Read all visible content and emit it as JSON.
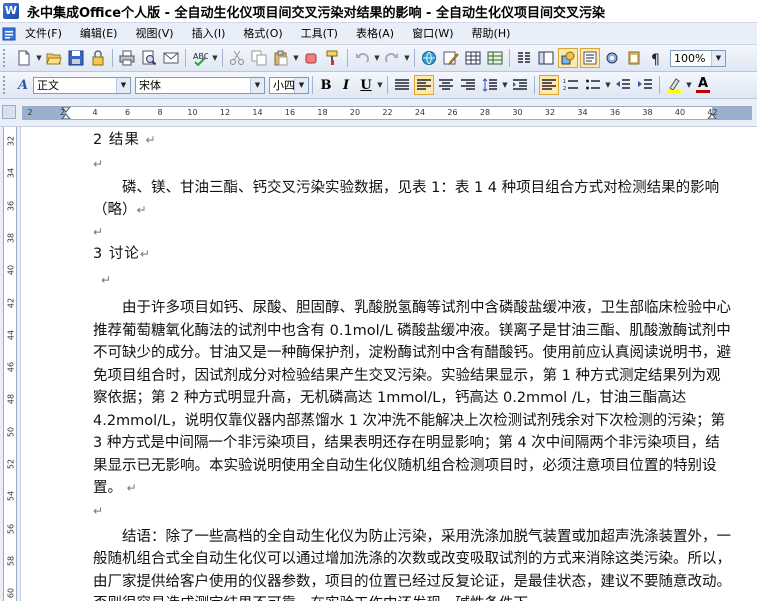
{
  "window": {
    "app_icon_glyph": "W",
    "title": "永中集成Office个人版 - 全自动生化仪项目间交叉污染对结果的影响 - 全自动生化仪项目间交叉污染"
  },
  "menu": {
    "items": [
      {
        "label": "文件(F)",
        "id": "file"
      },
      {
        "label": "编辑(E)",
        "id": "edit"
      },
      {
        "label": "视图(V)",
        "id": "view"
      },
      {
        "label": "插入(I)",
        "id": "insert"
      },
      {
        "label": "格式(O)",
        "id": "format"
      },
      {
        "label": "工具(T)",
        "id": "tools"
      },
      {
        "label": "表格(A)",
        "id": "table"
      },
      {
        "label": "窗口(W)",
        "id": "window"
      },
      {
        "label": "帮助(H)",
        "id": "help"
      }
    ]
  },
  "toolbar": {
    "zoom": "100%",
    "icons": [
      "new-document-icon",
      "open-folder-icon",
      "save-icon",
      "print-icon",
      "print-preview-icon",
      "spell-check-icon",
      "format-painter-icon",
      "cut-icon",
      "copy-icon",
      "paste-icon",
      "undo-icon",
      "redo-icon",
      "hyperlink-icon",
      "table-icon",
      "columns-icon",
      "drawing-icon",
      "show-marks-icon"
    ]
  },
  "format_bar": {
    "style": "正文",
    "font": "宋体",
    "size": "小四",
    "bold_label": "B",
    "italic_label": "I",
    "underline_label": "U",
    "font_color_label": "A",
    "style_icon_label": "A"
  },
  "ruler": {
    "labels": [
      "2",
      "2",
      "4",
      "6",
      "8",
      "10",
      "12",
      "14",
      "16",
      "18",
      "20",
      "22",
      "24",
      "26",
      "28",
      "30",
      "32",
      "34",
      "36",
      "38",
      "40",
      "42"
    ]
  },
  "vruler": {
    "labels": [
      "32",
      "34",
      "36",
      "38",
      "40",
      "42",
      "44",
      "46",
      "48",
      "50",
      "52",
      "54",
      "56",
      "58",
      "60"
    ]
  },
  "document": {
    "section2_heading": "2   结果",
    "section2_body": "磷、镁、甘油三酯、钙交叉污染实验数据，见表 1：表 1   4 种项目组合方式对检测结果的影响（略）",
    "section3_heading": "3   讨论",
    "discussion": "由于许多项目如钙、尿酸、胆固醇、乳酸脱氢酶等试剂中含磷酸盐缓冲液，卫生部临床检验中心推荐葡萄糖氧化酶法的试剂中也含有 0.1mol/L 磷酸盐缓冲液。镁离子是甘油三酯、肌酸激酶试剂中不可缺少的成分。甘油又是一种酶保护剂，淀粉酶试剂中含有醋酸钙。使用前应认真阅读说明书，避免项目组合时，因试剂成分对检验结果产生交叉污染。实验结果显示，第 1 种方式测定结果列为观察依据；第 2 种方式明显升高，无机磷高达 1mmol/L，钙高达 0.2mmol /L，甘油三酯高达 4.2mmol/L，说明仅靠仪器内部蒸馏水 1 次冲洗不能解决上次检测试剂残余对下次检测的污染；第 3 种方式是中间隔一个非污染项目，结果表明还存在明显影响；第 4 次中间隔两个非污染项目，结果显示已无影响。本实验说明使用全自动生化仪随机组合检测项目时，必须注意项目位置的特别设置。",
    "conclusion": "结语：除了一些高档的全自动生化仪为防止污染，采用洗涤加脱气装置或加超声洗涤装置外，一般随机组合式全自动生化仪可以通过增加洗涤的次数或改变吸取试剂的方式来消除这类污染。所以，由厂家提供给客户使用的仪器参数，项目的位置已经过反复论证，是最佳状态，建议不要随意改动。否则很容易造成测定结果不可靠。在实验工作中还发现，碱性条件下",
    "return_mark": "↵"
  }
}
